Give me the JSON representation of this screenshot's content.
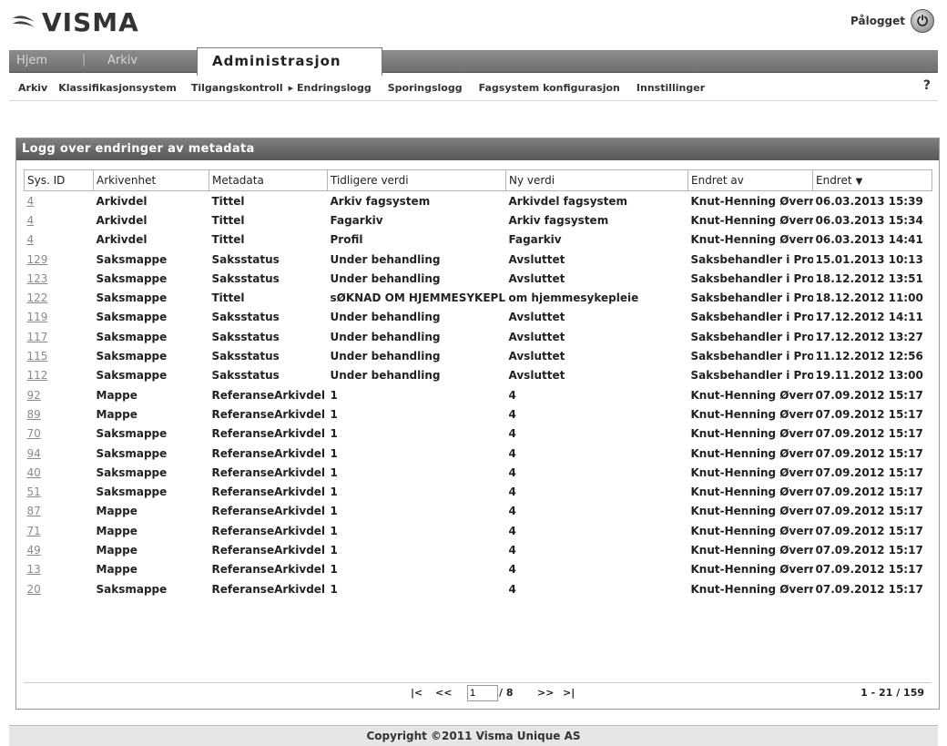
{
  "header": {
    "logo_text": "VISMA",
    "logged_in_label": "Pålogget"
  },
  "tabs": {
    "hjem": "Hjem",
    "separator": "|",
    "arkiv": "Arkiv",
    "active": "Administrasjon"
  },
  "subnav": {
    "items": [
      "Arkiv",
      "Klassifikasjonsystem",
      "Tilgangskontroll",
      "▸ Endringslogg",
      "Sporingslogg",
      "Fagsystem konfigurasjon",
      "Innstillinger"
    ],
    "help": "?"
  },
  "panel": {
    "title": "Logg over endringer av metadata"
  },
  "table": {
    "headers": [
      "Sys. ID",
      "Arkivenhet",
      "Metadata",
      "Tidligere verdi",
      "Ny verdi",
      "Endret av",
      "Endret"
    ],
    "sort_indicator": "▼",
    "rows": [
      [
        "4",
        "Arkivdel",
        "Tittel",
        "Arkiv fagsystem",
        "Arkivdel fagsystem",
        "Knut-Henning Øverr",
        "06.03.2013 15:39"
      ],
      [
        "4",
        "Arkivdel",
        "Tittel",
        "Fagarkiv",
        "Arkiv fagsystem",
        "Knut-Henning Øverr",
        "06.03.2013 15:34"
      ],
      [
        "4",
        "Arkivdel",
        "Tittel",
        "Profil",
        "Fagarkiv",
        "Knut-Henning Øverr",
        "06.03.2013 14:41"
      ],
      [
        "129",
        "Saksmappe",
        "Saksstatus",
        "Under behandling",
        "Avsluttet",
        "Saksbehandler i Prol",
        "15.01.2013 10:13"
      ],
      [
        "123",
        "Saksmappe",
        "Saksstatus",
        "Under behandling",
        "Avsluttet",
        "Saksbehandler i Prol",
        "18.12.2012 13:51"
      ],
      [
        "122",
        "Saksmappe",
        "Tittel",
        "sØKNAD OM HJEMMESYKEPLII",
        "om hjemmesykepleie",
        "Saksbehandler i Prol",
        "18.12.2012 11:00"
      ],
      [
        "119",
        "Saksmappe",
        "Saksstatus",
        "Under behandling",
        "Avsluttet",
        "Saksbehandler i Prol",
        "17.12.2012 14:11"
      ],
      [
        "117",
        "Saksmappe",
        "Saksstatus",
        "Under behandling",
        "Avsluttet",
        "Saksbehandler i Prol",
        "17.12.2012 13:27"
      ],
      [
        "115",
        "Saksmappe",
        "Saksstatus",
        "Under behandling",
        "Avsluttet",
        "Saksbehandler i Prol",
        "11.12.2012 12:56"
      ],
      [
        "112",
        "Saksmappe",
        "Saksstatus",
        "Under behandling",
        "Avsluttet",
        "Saksbehandler i Prol",
        "19.11.2012 13:00"
      ],
      [
        "92",
        "Mappe",
        "ReferanseArkivdel",
        "1",
        "4",
        "Knut-Henning Øverr",
        "07.09.2012 15:17"
      ],
      [
        "89",
        "Mappe",
        "ReferanseArkivdel",
        "1",
        "4",
        "Knut-Henning Øverr",
        "07.09.2012 15:17"
      ],
      [
        "70",
        "Saksmappe",
        "ReferanseArkivdel",
        "1",
        "4",
        "Knut-Henning Øverr",
        "07.09.2012 15:17"
      ],
      [
        "94",
        "Saksmappe",
        "ReferanseArkivdel",
        "1",
        "4",
        "Knut-Henning Øverr",
        "07.09.2012 15:17"
      ],
      [
        "40",
        "Saksmappe",
        "ReferanseArkivdel",
        "1",
        "4",
        "Knut-Henning Øverr",
        "07.09.2012 15:17"
      ],
      [
        "51",
        "Saksmappe",
        "ReferanseArkivdel",
        "1",
        "4",
        "Knut-Henning Øverr",
        "07.09.2012 15:17"
      ],
      [
        "87",
        "Mappe",
        "ReferanseArkivdel",
        "1",
        "4",
        "Knut-Henning Øverr",
        "07.09.2012 15:17"
      ],
      [
        "71",
        "Mappe",
        "ReferanseArkivdel",
        "1",
        "4",
        "Knut-Henning Øverr",
        "07.09.2012 15:17"
      ],
      [
        "49",
        "Mappe",
        "ReferanseArkivdel",
        "1",
        "4",
        "Knut-Henning Øverr",
        "07.09.2012 15:17"
      ],
      [
        "13",
        "Mappe",
        "ReferanseArkivdel",
        "1",
        "4",
        "Knut-Henning Øverr",
        "07.09.2012 15:17"
      ],
      [
        "20",
        "Saksmappe",
        "ReferanseArkivdel",
        "1",
        "4",
        "Knut-Henning Øverr",
        "07.09.2012 15:17"
      ]
    ]
  },
  "pager": {
    "first": "|<",
    "prev": "<<",
    "page_value": "1",
    "total": "/ 8",
    "next": ">>",
    "last": ">|",
    "range": "1 - 21 / 159"
  },
  "footer": {
    "copyright": "Copyright ©2011 Visma Unique AS"
  }
}
